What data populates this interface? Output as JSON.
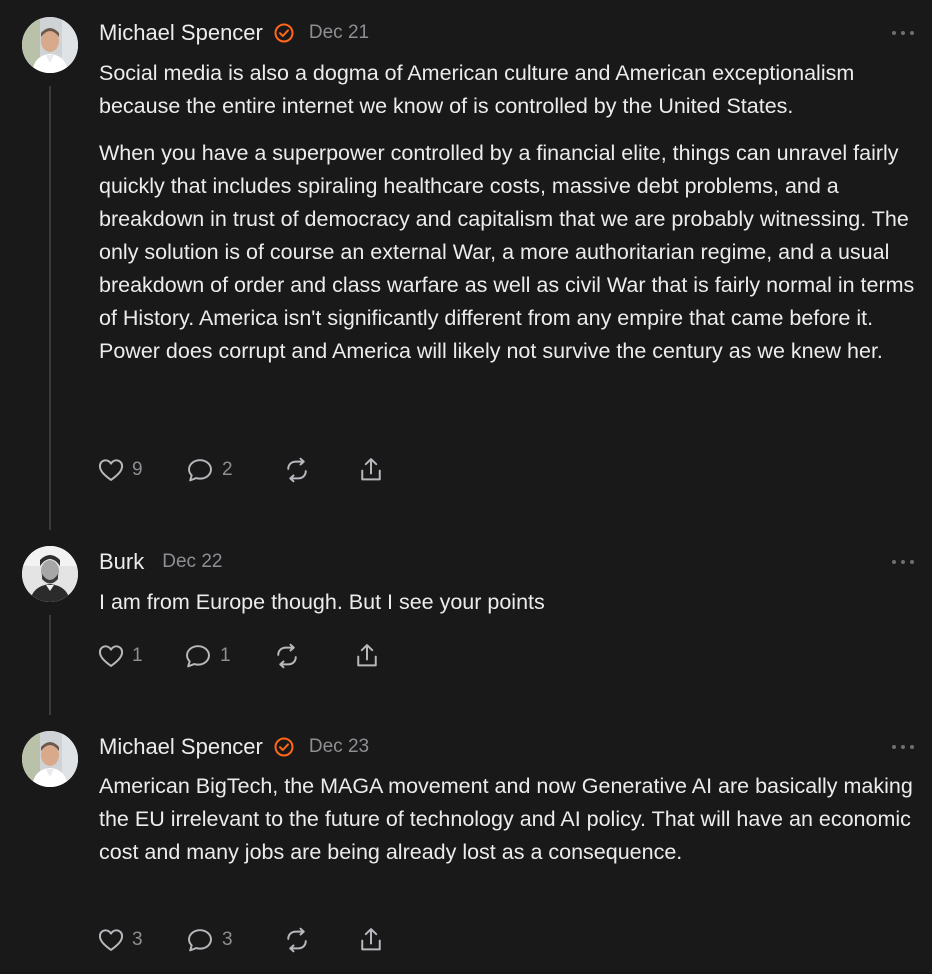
{
  "comments": [
    {
      "author": "Michael Spencer",
      "verified": true,
      "date": "Dec 21",
      "paragraphs": [
        "Social media is also a dogma of American culture and American exceptionalism because the entire internet we know of is controlled by the United States.",
        "When you have a superpower controlled by a financial elite, things can unravel fairly quickly that includes spiraling healthcare costs, massive debt problems, and a breakdown in trust of democracy and capitalism that we are probably witnessing. The only solution is of course an external War, a more authoritarian regime, and a usual breakdown of order and class warfare as well as civil War that is fairly normal in terms of History. America isn't significantly different from any empire that came before it. Power does corrupt and America will likely not survive the century as we knew her."
      ],
      "likes": "9",
      "replies": "2"
    },
    {
      "author": "Burk",
      "verified": false,
      "date": "Dec 22",
      "paragraphs": [
        "I am from Europe though. But I see your points"
      ],
      "likes": "1",
      "replies": "1"
    },
    {
      "author": "Michael Spencer",
      "verified": true,
      "date": "Dec 23",
      "paragraphs": [
        "American BigTech, the MAGA movement and now Generative AI are basically making the EU irrelevant to the future of technology and AI policy. That will have an economic cost and many jobs are being already lost as a consequence."
      ],
      "likes": "3",
      "replies": "3"
    }
  ],
  "icons": {
    "verified": "verified-badge-icon",
    "more": "more-options-icon",
    "like": "heart-icon",
    "reply": "comment-bubble-icon",
    "restack": "restack-icon",
    "share": "share-icon"
  },
  "colors": {
    "background": "#19191a",
    "text": "#ececec",
    "muted": "#8e8e93",
    "accent": "#ff6719",
    "thread_line": "#3a3a3c"
  }
}
